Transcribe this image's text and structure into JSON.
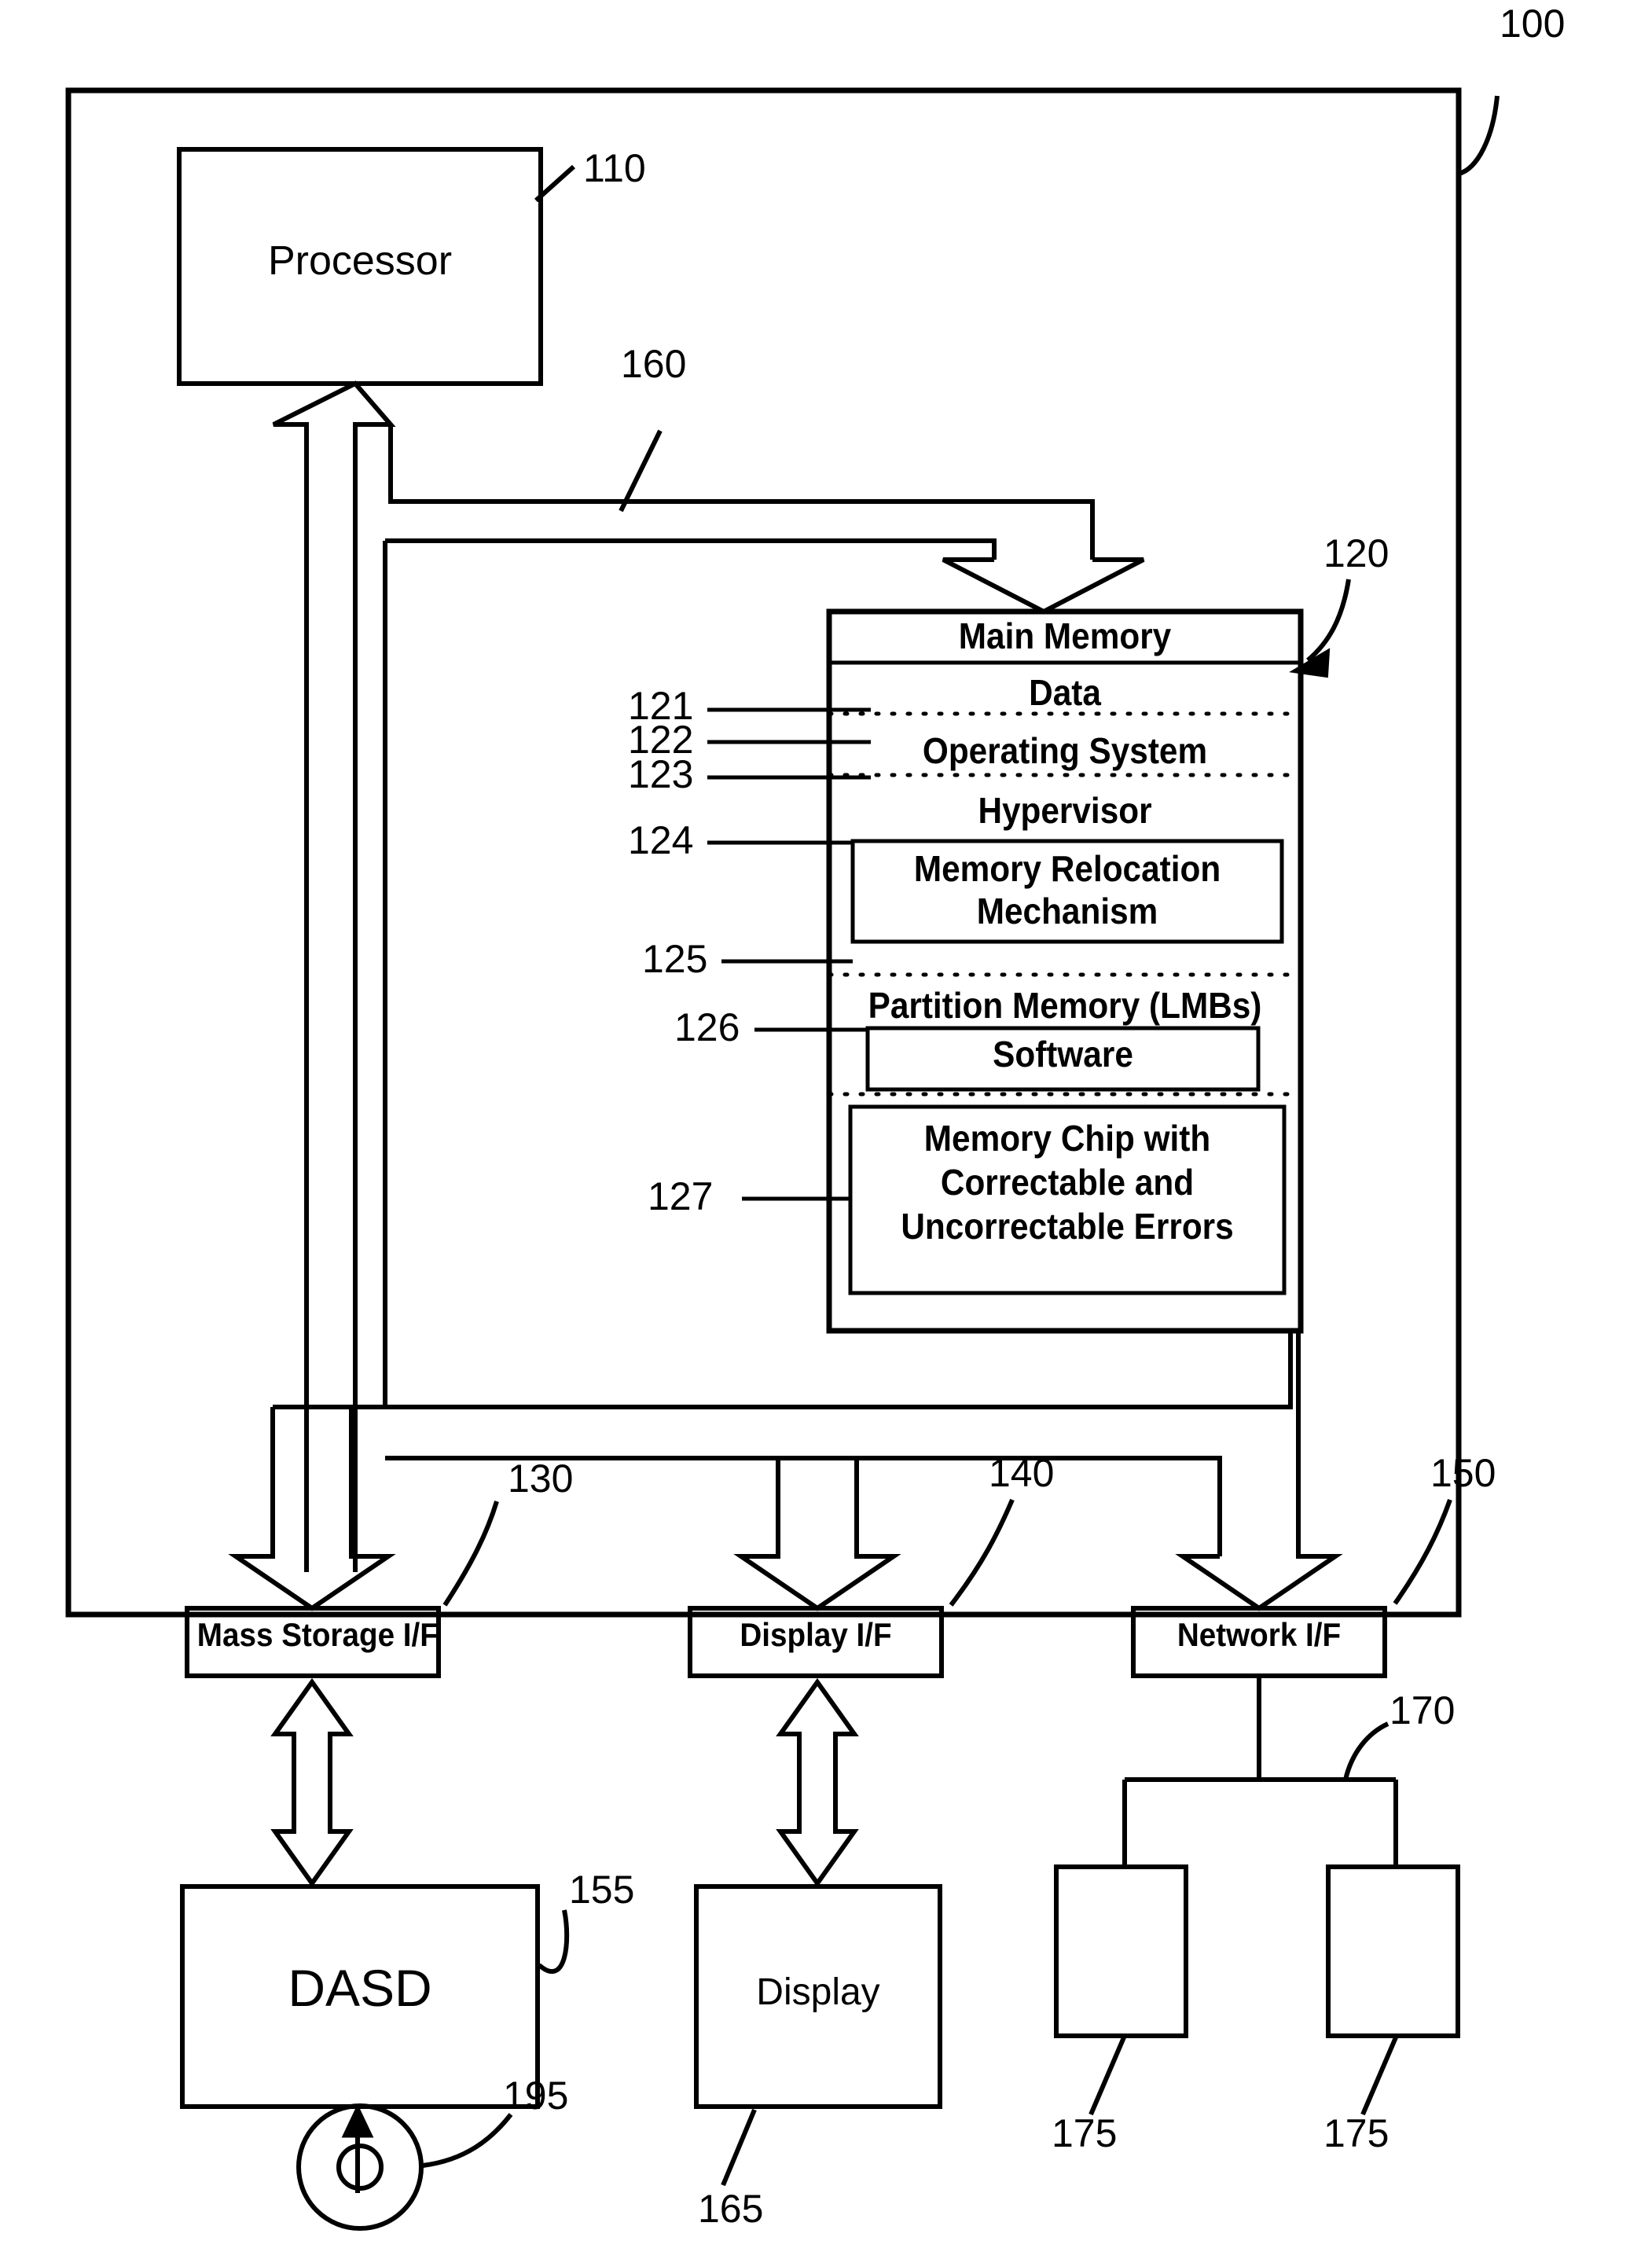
{
  "figure": {
    "type": "patent-block-diagram",
    "system_ref": "100"
  },
  "blocks": {
    "processor": {
      "label": "Processor",
      "ref": "110"
    },
    "main_memory": {
      "label": "Main Memory",
      "ref": "120"
    },
    "memory_rows": [
      {
        "label": "Data",
        "ref": "121"
      },
      {
        "label": "Operating System",
        "ref": "122"
      },
      {
        "label": "Hypervisor",
        "ref": "123"
      },
      {
        "label": "Memory Relocation Mechanism",
        "line1": "Memory Relocation",
        "line2": "Mechanism",
        "ref": "124"
      },
      {
        "label": "Partition Memory (LMBs)",
        "ref": "125"
      },
      {
        "label": "Software",
        "ref": "126"
      },
      {
        "label": "Memory Chip with Correctable and Uncorrectable Errors",
        "line1": "Memory Chip with",
        "line2": "Correctable and",
        "line3": "Uncorrectable Errors",
        "ref": "127"
      }
    ],
    "bus": {
      "ref": "160"
    },
    "mass_storage_if": {
      "label": "Mass Storage I/F",
      "ref": "130"
    },
    "display_if": {
      "label": "Display I/F",
      "ref": "140"
    },
    "network_if": {
      "label": "Network I/F",
      "ref": "150"
    },
    "dasd": {
      "label": "DASD",
      "ref": "155"
    },
    "display": {
      "label": "Display",
      "ref": "165"
    },
    "network": {
      "ref": "170"
    },
    "network_nodes": [
      {
        "ref": "175"
      },
      {
        "ref": "175"
      }
    ],
    "removable_media": {
      "ref": "195"
    }
  },
  "colors": {
    "stroke": "#000000",
    "background": "#ffffff"
  }
}
